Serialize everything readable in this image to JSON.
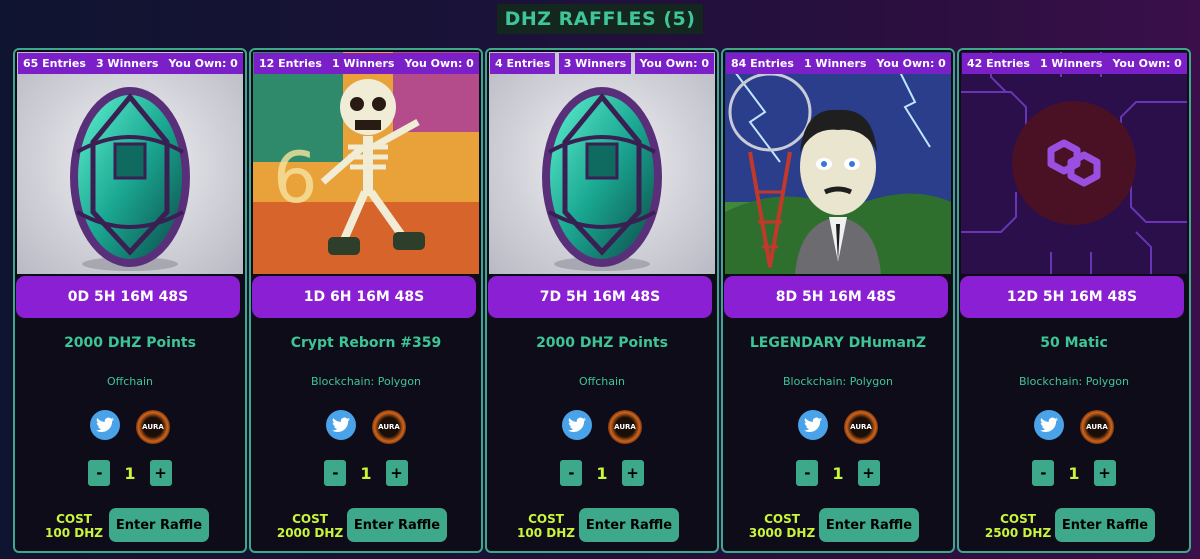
{
  "header": {
    "title": "DHZ RAFFLES (5)"
  },
  "colors": {
    "accent": "#3ea88a",
    "badge": "#7b1fc9",
    "timer": "#8a1fd3",
    "cost": "#c9f53b"
  },
  "raffles": [
    {
      "entries": "65 Entries",
      "winners": "3 Winners",
      "owned": "You Own: 0",
      "image": "green-egg-gem",
      "timer": "0D 5H 16M 48S",
      "prize": "2000 DHZ Points",
      "chain": "Offchain",
      "quantity": "1",
      "minus": "-",
      "plus": "+",
      "cost_label": "COST",
      "cost_value": "100 DHZ",
      "enter_label": "Enter Raffle"
    },
    {
      "entries": "12 Entries",
      "winners": "1 Winners",
      "owned": "You Own: 0",
      "image": "dancing-skeleton",
      "timer": "1D 6H 16M 48S",
      "prize": "Crypt Reborn #359",
      "chain": "Blockchain: Polygon",
      "quantity": "1",
      "minus": "-",
      "plus": "+",
      "cost_label": "COST",
      "cost_value": "2000 DHZ",
      "enter_label": "Enter Raffle"
    },
    {
      "entries": "4 Entries",
      "winners": "3 Winners",
      "owned": "You Own: 0",
      "image": "green-egg-gem",
      "timer": "7D 5H 16M 48S",
      "prize": "2000 DHZ Points",
      "chain": "Offchain",
      "quantity": "1",
      "minus": "-",
      "plus": "+",
      "cost_label": "COST",
      "cost_value": "100 DHZ",
      "enter_label": "Enter Raffle"
    },
    {
      "entries": "84 Entries",
      "winners": "1 Winners",
      "owned": "You Own: 0",
      "image": "tesla-character-tower",
      "timer": "8D 5H 16M 48S",
      "prize": "LEGENDARY DHumanZ",
      "chain": "Blockchain: Polygon",
      "quantity": "1",
      "minus": "-",
      "plus": "+",
      "cost_label": "COST",
      "cost_value": "3000 DHZ",
      "enter_label": "Enter Raffle"
    },
    {
      "entries": "42 Entries",
      "winners": "1 Winners",
      "owned": "You Own: 0",
      "image": "polygon-matic-logo",
      "timer": "12D 5H 16M 48S",
      "prize": "50 Matic",
      "chain": "Blockchain: Polygon",
      "quantity": "1",
      "minus": "-",
      "plus": "+",
      "cost_label": "COST",
      "cost_value": "2500 DHZ",
      "enter_label": "Enter Raffle"
    }
  ]
}
